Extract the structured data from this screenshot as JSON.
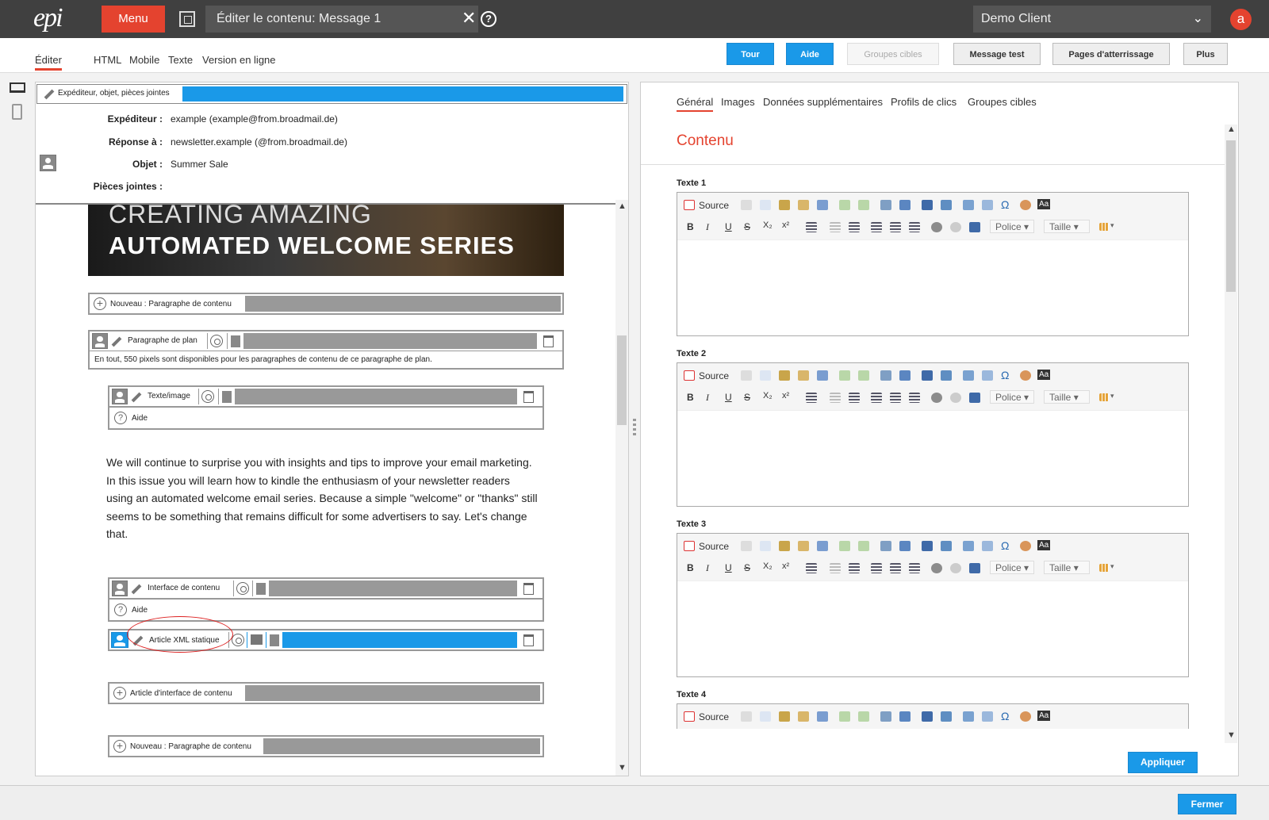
{
  "header": {
    "logo": "epi",
    "menu_label": "Menu",
    "title": "Éditer le contenu: Message 1",
    "client": "Demo Client",
    "avatar_letter": "a"
  },
  "tabs": [
    {
      "label": "Éditer"
    },
    {
      "label": "HTML"
    },
    {
      "label": "Mobile"
    },
    {
      "label": "Texte"
    },
    {
      "label": "Version en ligne"
    }
  ],
  "toolbar": {
    "tour": "Tour",
    "aide": "Aide",
    "groupes_cibles": "Groupes cibles",
    "message_test": "Message test",
    "pages_atterrissage": "Pages d'atterrissage",
    "plus": "Plus"
  },
  "left": {
    "header_section": "Expéditeur, objet, pièces jointes",
    "fields": [
      {
        "label": "Expéditeur :",
        "value": "example (example@from.broadmail.de)"
      },
      {
        "label": "Réponse à :",
        "value": "newsletter.example (@from.broadmail.de)"
      },
      {
        "label": "Objet :",
        "value": "Summer Sale"
      },
      {
        "label": "Pièces jointes :",
        "value": ""
      }
    ],
    "banner_line1": "CREATING AMAZING",
    "banner_line2": "AUTOMATED WELCOME SERIES",
    "new_paragraph": "Nouveau : Paragraphe de contenu",
    "plan_paragraph": "Paragraphe de plan",
    "plan_info": "En tout, 550 pixels sont disponibles pour les paragraphes de contenu de ce paragraphe de plan.",
    "texte_image": "Texte/image",
    "aide": "Aide",
    "body_text": "We will continue to surprise you with insights and tips to improve your email marketing. In this issue you will learn how to kindle the enthusiasm of your newsletter readers using an automated welcome email series. Because a simple \"welcome\" or \"thanks\" still seems to be something that remains difficult for some advertisers to say. Let's change that.",
    "interface_contenu": "Interface de contenu",
    "aide2": "Aide",
    "article_xml": "Article XML statique",
    "article_interface": "Article d'interface de contenu",
    "new_paragraph2": "Nouveau : Paragraphe de contenu"
  },
  "right": {
    "tabs": [
      {
        "label": "Général"
      },
      {
        "label": "Images"
      },
      {
        "label": "Données supplémentaires"
      },
      {
        "label": "Profils de clics"
      },
      {
        "label": "Groupes cibles"
      }
    ],
    "section_title": "Contenu",
    "editors": [
      {
        "label": "Texte 1"
      },
      {
        "label": "Texte 2"
      },
      {
        "label": "Texte 3"
      },
      {
        "label": "Texte 4"
      }
    ],
    "source": "Source",
    "bold": "B",
    "italic": "I",
    "underline": "U",
    "strike": "S",
    "sub": "X₂",
    "sup": "x²",
    "omega": "Ω",
    "aa": "Aa",
    "font_label": "Police",
    "size_label": "Taille",
    "apply": "Appliquer"
  },
  "footer": {
    "close": "Fermer"
  },
  "colors": {
    "accent": "#e4432f",
    "blue": "#1a99e8",
    "topbar": "#404040"
  }
}
